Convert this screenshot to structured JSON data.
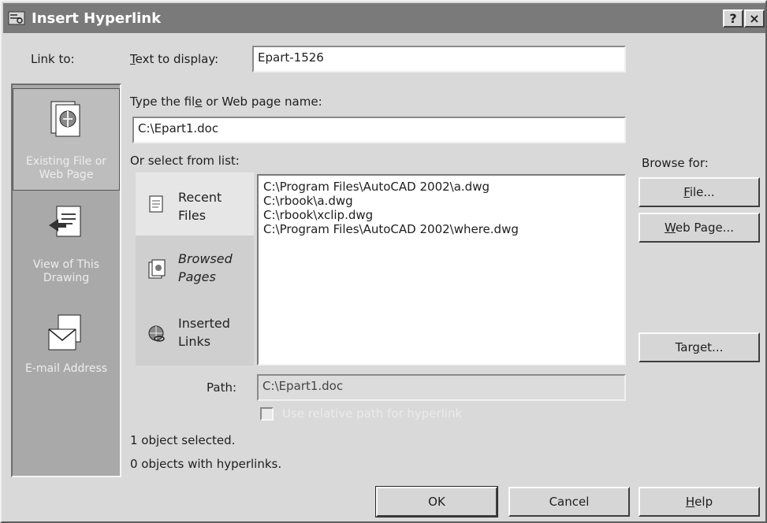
{
  "window": {
    "title": "Insert Hyperlink",
    "help_btn": "?",
    "close_btn": "×"
  },
  "link_to": {
    "label": "Link to:",
    "items": [
      {
        "label": "Existing File or Web Page",
        "icon": "existing-file-icon",
        "selected": true
      },
      {
        "label": "View of This Drawing",
        "icon": "drawing-view-icon",
        "selected": false
      },
      {
        "label": "E-mail Address",
        "icon": "email-icon",
        "selected": false
      }
    ]
  },
  "text_to_display": {
    "label_pre": "",
    "label_ul": "T",
    "label_post": "ext to display:",
    "value": "Epart-1526"
  },
  "filename": {
    "label_pre": "Type the fil",
    "label_ul": "e",
    "label_post": " or Web page name:",
    "value": "C:\\Epart1.doc"
  },
  "select_list": {
    "label": "Or select from list:",
    "tabs": [
      {
        "line1": "Recent",
        "line2": "Files",
        "icon": "recent-files-icon",
        "selected": true
      },
      {
        "line1": "Browsed",
        "line2": "Pages",
        "icon": "browsed-pages-icon",
        "selected": false
      },
      {
        "line1": "Inserted",
        "line2": "Links",
        "icon": "inserted-links-icon",
        "selected": false
      }
    ],
    "items": [
      "C:\\Program Files\\AutoCAD 2002\\a.dwg",
      "C:\\rbook\\a.dwg",
      "C:\\rbook\\xclip.dwg",
      "C:\\Program Files\\AutoCAD 2002\\where.dwg"
    ]
  },
  "browse": {
    "label": "Browse for:",
    "file": {
      "pre": "",
      "ul": "F",
      "post": "ile..."
    },
    "web": {
      "pre": "",
      "ul": "W",
      "post": "eb Page..."
    },
    "target": {
      "pre": "Tar",
      "ul": "g",
      "post": "et..."
    }
  },
  "path": {
    "label": "Path:",
    "value": "C:\\Epart1.doc"
  },
  "relative_path": {
    "label": "Use relative path for hyperlink",
    "checked": false
  },
  "status": {
    "line1": "1 object selected.",
    "line2": "0 objects with hyperlinks."
  },
  "buttons": {
    "ok": "OK",
    "cancel": "Cancel",
    "help": {
      "pre": "",
      "ul": "H",
      "post": "elp"
    }
  }
}
